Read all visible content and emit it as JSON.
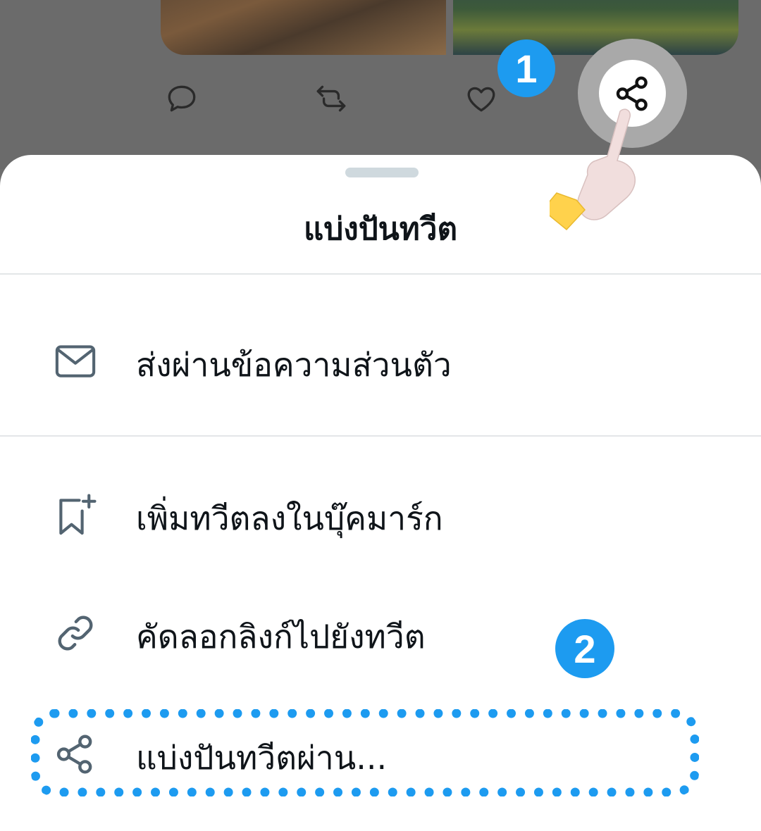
{
  "sheet": {
    "title": "แบ่งปันทวีต"
  },
  "menu": {
    "items": [
      {
        "label": "ส่งผ่านข้อความส่วนตัว",
        "icon": "mail-icon"
      },
      {
        "label": "เพิ่มทวีตลงในบุ๊คมาร์ก",
        "icon": "bookmark-add-icon"
      },
      {
        "label": "คัดลอกลิงก์ไปยังทวีต",
        "icon": "link-icon"
      },
      {
        "label": "แบ่งปันทวีตผ่าน...",
        "icon": "share-icon"
      }
    ]
  },
  "annotations": {
    "step1": "1",
    "step2": "2"
  },
  "colors": {
    "accent": "#1d9bf0",
    "icon_gray": "#536471"
  }
}
